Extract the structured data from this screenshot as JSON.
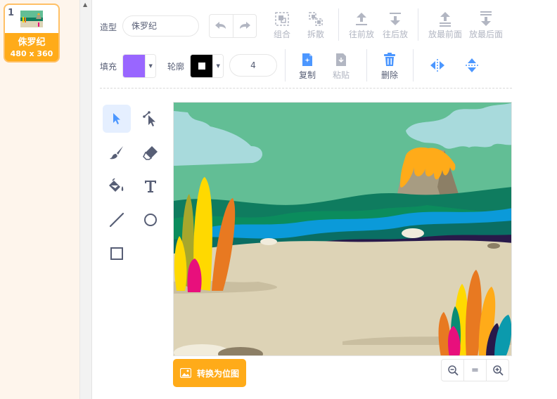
{
  "costumes": [
    {
      "index": "1",
      "name": "侏罗纪",
      "size": "480 x 360"
    }
  ],
  "toolbar": {
    "costume_label": "造型",
    "costume_name": "侏罗纪",
    "fill_label": "填充",
    "outline_label": "轮廓",
    "outline_width": "4",
    "group": "组合",
    "ungroup": "拆散",
    "forward": "往前放",
    "backward": "往后放",
    "front": "放最前面",
    "back": "放最后面",
    "copy": "复制",
    "paste": "粘贴",
    "delete": "删除"
  },
  "colors": {
    "fill": "#9966ff",
    "outline": "#000000",
    "accent": "#ffab19",
    "active_blue": "#4c97ff",
    "disabled": "#b2b6c2"
  },
  "tools": [
    "select-tool",
    "reshape-tool",
    "brush-tool",
    "eraser-tool",
    "fill-tool",
    "text-tool",
    "line-tool",
    "circle-tool",
    "rectangle-tool"
  ],
  "canvas": {
    "convert_button": "转换为位图"
  },
  "zoom": {
    "out": "−",
    "reset": "=",
    "in": "+"
  }
}
